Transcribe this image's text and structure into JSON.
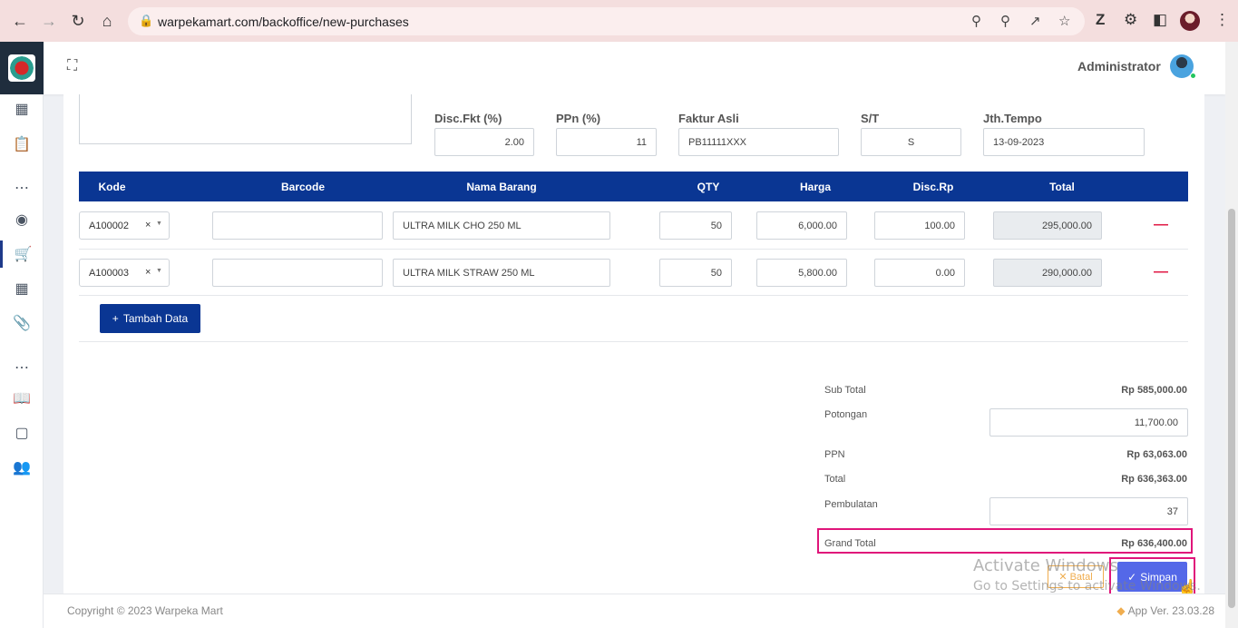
{
  "browser": {
    "url": "warpekamart.com/backoffice/new-purchases"
  },
  "header": {
    "user_name": "Administrator"
  },
  "form": {
    "disc_fkt_label": "Disc.Fkt (%)",
    "disc_fkt_value": "2.00",
    "ppn_label": "PPn (%)",
    "ppn_value": "11",
    "faktur_asli_label": "Faktur Asli",
    "faktur_asli_value": "PB11111XXX",
    "st_label": "S/T",
    "st_value": "S",
    "jth_tempo_label": "Jth.Tempo",
    "jth_tempo_value": "13-09-2023"
  },
  "table": {
    "columns": [
      "Kode",
      "Barcode",
      "Nama Barang",
      "QTY",
      "Harga",
      "Disc.Rp",
      "Total"
    ],
    "rows": [
      {
        "kode": "A100002",
        "barcode": "",
        "nama": "ULTRA MILK CHO 250 ML",
        "qty": "50",
        "harga": "6,000.00",
        "disc": "100.00",
        "total": "295,000.00"
      },
      {
        "kode": "A100003",
        "barcode": "",
        "nama": "ULTRA MILK STRAW 250 ML",
        "qty": "50",
        "harga": "5,800.00",
        "disc": "0.00",
        "total": "290,000.00"
      }
    ],
    "add_label": "Tambah Data",
    "remove_symbol": "—",
    "clear_symbol": "×"
  },
  "totals": {
    "sub_total_label": "Sub Total",
    "sub_total_value": "Rp 585,000.00",
    "potongan_label": "Potongan",
    "potongan_value": "11,700.00",
    "ppn_label": "PPN",
    "ppn_value": "Rp 63,063.00",
    "total_label": "Total",
    "total_value": "Rp 636,363.00",
    "pembulatan_label": "Pembulatan",
    "pembulatan_value": "37",
    "grand_total_label": "Grand Total",
    "grand_total_value": "Rp 636,400.00"
  },
  "actions": {
    "batal_label": "Batal",
    "simpan_label": "Simpan"
  },
  "watermark": {
    "line1": "Activate Windows",
    "line2": "Go to Settings to activate Windows."
  },
  "footer": {
    "copyright": "Copyright © 2023 Warpeka Mart",
    "version": "App Ver. 23.03.28"
  },
  "colors": {
    "primary": "#0a3693",
    "accent": "#5468e8",
    "highlight": "#e0157a",
    "danger": "#e11d48",
    "warning": "#f0ad4e"
  }
}
